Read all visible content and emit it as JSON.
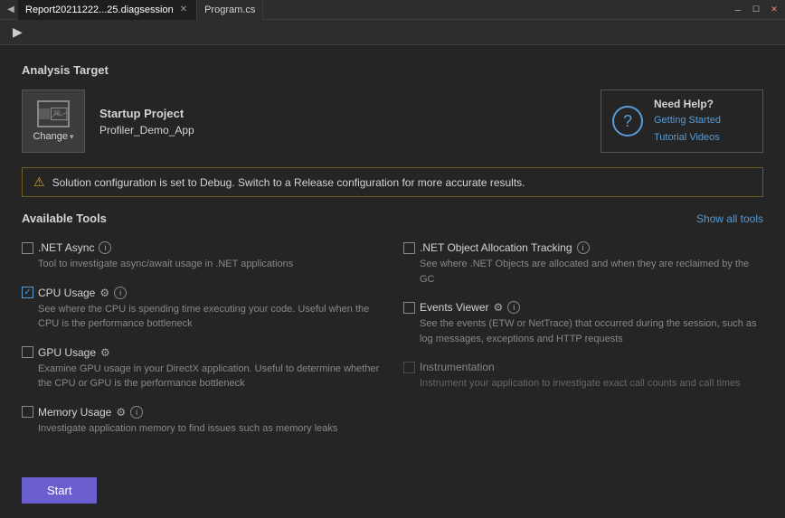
{
  "titlebar": {
    "tabs": [
      {
        "id": "diag",
        "label": "Report20211222...25.diagsession",
        "active": true,
        "closable": true
      },
      {
        "id": "program",
        "label": "Program.cs",
        "active": false,
        "closable": false
      }
    ],
    "scroll_left": "◀",
    "win_minimize": "─",
    "win_restore": "☐",
    "win_close": "✕"
  },
  "toolbar": {
    "back_icon": "▶"
  },
  "analysis_target": {
    "title": "Analysis Target",
    "change_target_label": "Change",
    "change_target_dropdown": "▾",
    "startup_project_label": "Startup Project",
    "startup_project_value": "Profiler_Demo_App",
    "help": {
      "title": "Need Help?",
      "link1": "Getting Started",
      "link2": "Tutorial Videos"
    }
  },
  "warning": {
    "icon": "⚠",
    "text": "Solution configuration is set to Debug. Switch to a Release configuration for more accurate results."
  },
  "available_tools": {
    "title": "Available Tools",
    "show_all": "Show all tools",
    "tools": [
      {
        "id": "dotnet-async",
        "name": ".NET Async",
        "checked": false,
        "disabled": false,
        "has_info": true,
        "has_settings": false,
        "description": "Tool to investigate async/await usage in .NET applications"
      },
      {
        "id": "dotnet-object-allocation",
        "name": ".NET Object Allocation Tracking",
        "checked": false,
        "disabled": false,
        "has_info": true,
        "has_settings": false,
        "description": "See where .NET Objects are allocated and when they are reclaimed by the GC"
      },
      {
        "id": "cpu-usage",
        "name": "CPU Usage",
        "checked": true,
        "disabled": false,
        "has_info": true,
        "has_settings": true,
        "description": "See where the CPU is spending time executing your code. Useful when the CPU is the performance bottleneck"
      },
      {
        "id": "events-viewer",
        "name": "Events Viewer",
        "checked": false,
        "disabled": false,
        "has_info": true,
        "has_settings": true,
        "description": "See the events (ETW or NetTrace) that occurred during the session, such as log messages, exceptions and HTTP requests"
      },
      {
        "id": "gpu-usage",
        "name": "GPU Usage",
        "checked": false,
        "disabled": false,
        "has_info": false,
        "has_settings": true,
        "description": "Examine GPU usage in your DirectX application. Useful to determine whether the CPU or GPU is the performance bottleneck"
      },
      {
        "id": "instrumentation",
        "name": "Instrumentation",
        "checked": false,
        "disabled": true,
        "has_info": false,
        "has_settings": false,
        "description": "Instrument your application to investigate exact call counts and call times"
      },
      {
        "id": "memory-usage",
        "name": "Memory Usage",
        "checked": false,
        "disabled": false,
        "has_info": true,
        "has_settings": true,
        "description": "Investigate application memory to find issues such as memory leaks"
      }
    ]
  },
  "bottom": {
    "start_label": "Start"
  }
}
